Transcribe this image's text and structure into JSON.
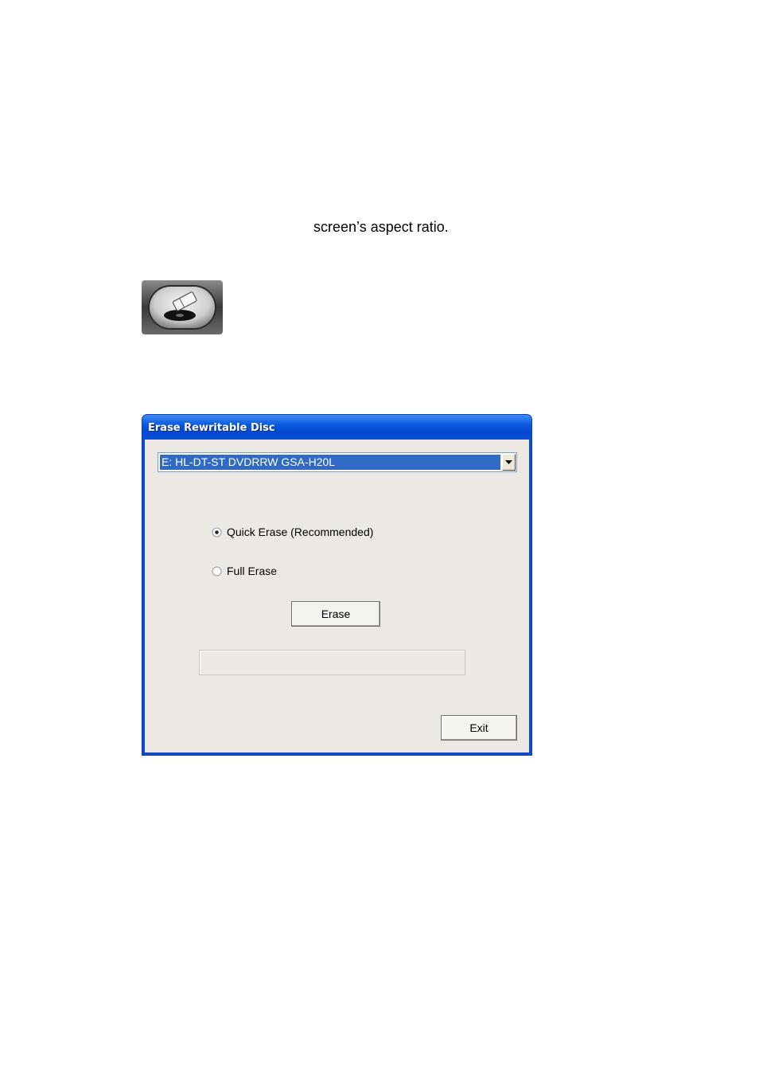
{
  "document": {
    "text_fragment": "screen’s aspect ratio."
  },
  "erase_icon": {
    "icon": "erase-disc-icon"
  },
  "dialog": {
    "title": "Erase Rewritable Disc",
    "drive_select": {
      "selected": "E: HL-DT-ST DVDRRW GSA-H20L"
    },
    "options": [
      {
        "label": "Quick Erase (Recommended)",
        "selected": true
      },
      {
        "label": "Full Erase",
        "selected": false
      }
    ],
    "erase_label": "Erase",
    "progress": 0,
    "exit_label": "Exit",
    "colors": {
      "title_bar": "#0a4ad6",
      "selection": "#316ac5",
      "client_background": "#ece9e4"
    }
  }
}
